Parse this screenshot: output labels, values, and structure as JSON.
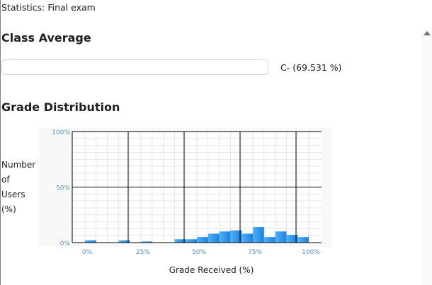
{
  "page_title": "Statistics: Final exam",
  "class_average": {
    "heading": "Class Average",
    "value_text": "C- (69.531 %)"
  },
  "grade_distribution": {
    "heading": "Grade Distribution",
    "y_axis_title_lines": [
      "Number",
      "of",
      "Users",
      "(%)"
    ],
    "x_axis_title": "Grade Received (%)"
  },
  "colors": {
    "bar_fill_light": "#4fb3f5",
    "bar_fill_dark": "#1e7fe0",
    "tick_label": "#5b8ec6",
    "grid_major": "#000000",
    "grid_minor": "#e6e6e6",
    "plot_background": "#f8f8f8"
  },
  "chart_data": {
    "type": "bar",
    "xlabel": "Grade Received (%)",
    "ylabel": "Number of Users (%)",
    "xlim": [
      0,
      100
    ],
    "ylim": [
      0,
      100
    ],
    "y_tick_labels": [
      "100%",
      "50%",
      "0%"
    ],
    "x_tick_labels": [
      "0%",
      "25%",
      "50%",
      "75%",
      "100%"
    ],
    "grid": true,
    "bins": [
      {
        "start": 0,
        "end": 5,
        "value": 2
      },
      {
        "start": 15,
        "end": 20,
        "value": 2
      },
      {
        "start": 25,
        "end": 30,
        "value": 1
      },
      {
        "start": 40,
        "end": 45,
        "value": 3
      },
      {
        "start": 45,
        "end": 50,
        "value": 3
      },
      {
        "start": 50,
        "end": 55,
        "value": 5
      },
      {
        "start": 55,
        "end": 60,
        "value": 8
      },
      {
        "start": 60,
        "end": 65,
        "value": 10
      },
      {
        "start": 65,
        "end": 70,
        "value": 11
      },
      {
        "start": 70,
        "end": 75,
        "value": 8
      },
      {
        "start": 75,
        "end": 80,
        "value": 14
      },
      {
        "start": 80,
        "end": 85,
        "value": 5
      },
      {
        "start": 85,
        "end": 90,
        "value": 10
      },
      {
        "start": 90,
        "end": 95,
        "value": 7
      },
      {
        "start": 95,
        "end": 100,
        "value": 5
      }
    ]
  }
}
